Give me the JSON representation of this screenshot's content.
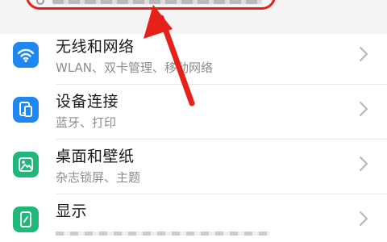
{
  "settings_list": [
    {
      "title": "无线和网络",
      "subtitle": "WLAN、双卡管理、移动网络",
      "icon": "wifi-icon",
      "icon_color": "#1e88f0"
    },
    {
      "title": "设备连接",
      "subtitle": "蓝牙、打印",
      "icon": "device-connection-icon",
      "icon_color": "#1e88f0"
    },
    {
      "title": "桌面和壁纸",
      "subtitle": "杂志锁屏、主题",
      "icon": "wallpaper-icon",
      "icon_color": "#1fb77a"
    },
    {
      "title": "显示",
      "subtitle": "",
      "icon": "display-icon",
      "icon_color": "#1fb77a"
    }
  ],
  "annotation": {
    "highlight_color": "#e8201a",
    "arrow_color": "#e8201a"
  }
}
